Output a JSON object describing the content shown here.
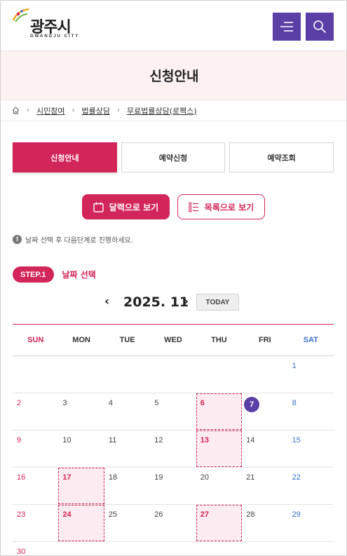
{
  "header": {
    "logo_text": "광주시",
    "logo_sub": "GWANGJU CITY",
    "menu_icon": "hamburger-icon",
    "search_icon": "search-icon",
    "accent": "#5b3fa6"
  },
  "page_title": "신청안내",
  "breadcrumb": {
    "home_icon": "home-icon",
    "items": [
      "시민참여",
      "법률상담",
      "무료법률상담(로펙스)"
    ]
  },
  "tabs": [
    {
      "label": "신청안내",
      "active": true
    },
    {
      "label": "예약신청",
      "active": false
    },
    {
      "label": "예약조회",
      "active": false
    }
  ],
  "view_toggle": {
    "calendar_label": "달력으로 보기",
    "list_label": "목록으로 보기",
    "active": "calendar"
  },
  "notice": "날짜 선택 후 다음단계로 진행하세요.",
  "step": {
    "badge": "STEP.1",
    "label": "날짜 선택"
  },
  "calendar": {
    "month_label": "2025. 11",
    "today_button": "TODAY",
    "weekdays": [
      "SUN",
      "MON",
      "TUE",
      "WED",
      "THU",
      "FRI",
      "SAT"
    ],
    "weeks": [
      [
        "",
        "",
        "",
        "",
        "",
        "",
        "1"
      ],
      [
        "2",
        "3",
        "4",
        "5",
        "6",
        "7",
        "8"
      ],
      [
        "9",
        "10",
        "11",
        "12",
        "13",
        "14",
        "15"
      ],
      [
        "16",
        "17",
        "18",
        "19",
        "20",
        "21",
        "22"
      ],
      [
        "23",
        "24",
        "25",
        "26",
        "27",
        "28",
        "29"
      ],
      [
        "30",
        "",
        "",
        "",
        "",
        "",
        ""
      ]
    ],
    "available_dates": [
      "6",
      "13",
      "17",
      "24",
      "27"
    ],
    "today_date": "7",
    "colors": {
      "primary": "#d2255a",
      "sunday": "#d2255a",
      "saturday": "#3a73c9",
      "today": "#5b3fa6"
    }
  }
}
